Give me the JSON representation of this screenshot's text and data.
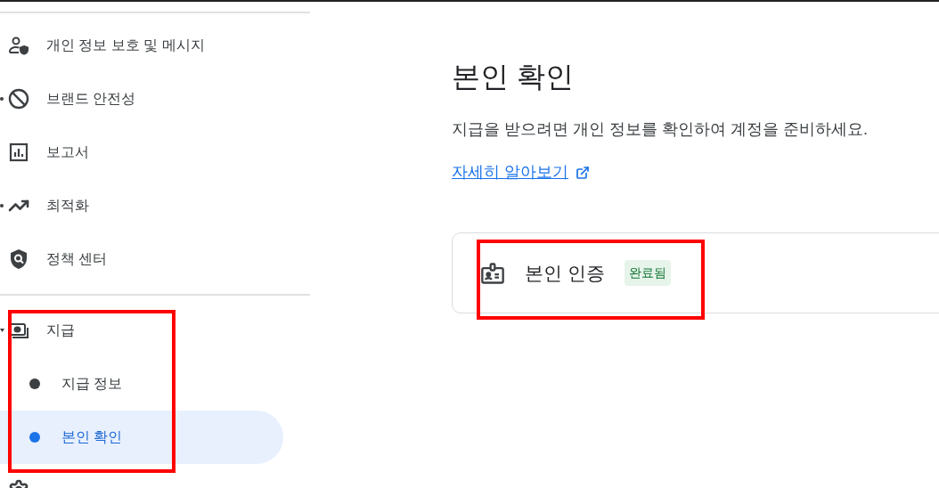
{
  "sidebar": {
    "items": [
      {
        "kind": "privacy",
        "label": "개인 정보 보호 및 메시지"
      },
      {
        "kind": "block",
        "label": "브랜드 안전성",
        "expanded": false
      },
      {
        "kind": "report",
        "label": "보고서"
      },
      {
        "kind": "trend",
        "label": "최적화",
        "expanded": false
      },
      {
        "kind": "policy",
        "label": "정책 센터"
      }
    ],
    "payments": {
      "kind": "money",
      "label": "지급",
      "expanded": true,
      "children": [
        {
          "label": "지급 정보",
          "selected": false
        },
        {
          "label": "본인 확인",
          "selected": true
        }
      ]
    }
  },
  "main": {
    "title": "본인 확인",
    "description": "지급을 받으려면 개인 정보를 확인하여 계정을 준비하세요.",
    "link": "자세히 알아보기",
    "card": {
      "label": "본인 인증",
      "status": "완료됨"
    }
  }
}
